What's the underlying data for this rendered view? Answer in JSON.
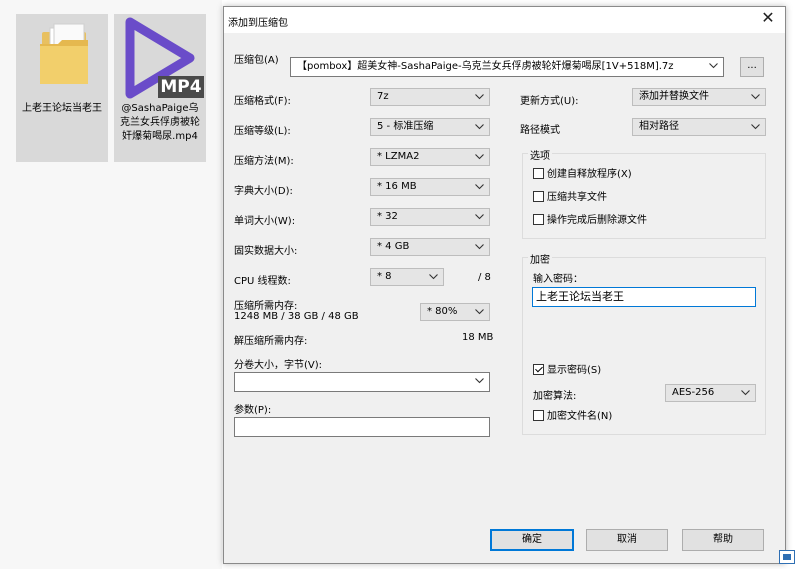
{
  "desktop": {
    "icons": [
      {
        "label": "上老王论坛当老王",
        "icon": "folder-icon"
      },
      {
        "label": "@SashaPaige乌克兰女兵俘虏被轮奸爆菊喝尿.mp4",
        "icon": "mp4-file-icon",
        "badge": "MP4"
      }
    ]
  },
  "dialog": {
    "title": "添加到压缩包",
    "archive_label": "压缩包(A)",
    "archive_value": "【pombox】超美女神-SashaPaige-乌克兰女兵俘虏被轮奸爆菊喝尿[1V+518M].7z",
    "browse_label": "...",
    "left": {
      "format_label": "压缩格式(F):",
      "format_value": "7z",
      "level_label": "压缩等级(L):",
      "level_value": "5 - 标准压缩",
      "method_label": "压缩方法(M):",
      "method_value": "* LZMA2",
      "dict_label": "字典大小(D):",
      "dict_value": "* 16 MB",
      "word_label": "单词大小(W):",
      "word_value": "* 32",
      "solid_label": "固实数据大小:",
      "solid_value": "* 4 GB",
      "threads_label": "CPU 线程数:",
      "threads_value": "* 8",
      "threads_max": "/ 8",
      "mem_comp_label": "压缩所需内存:",
      "mem_comp_value": "1248 MB / 38 GB / 48 GB",
      "mem_percent_value": "* 80%",
      "mem_decomp_label": "解压缩所需内存:",
      "mem_decomp_value": "18 MB",
      "volume_label": "分卷大小，字节(V):",
      "volume_value": "",
      "params_label": "参数(P):",
      "params_value": ""
    },
    "right": {
      "update_label": "更新方式(U):",
      "update_value": "添加并替换文件",
      "path_label": "路径模式",
      "path_value": "相对路径",
      "options_title": "选项",
      "options": [
        {
          "label": "创建自释放程序(X)",
          "checked": false
        },
        {
          "label": "压缩共享文件",
          "checked": false
        },
        {
          "label": "操作完成后删除源文件",
          "checked": false
        }
      ],
      "encrypt_title": "加密",
      "password_label": "输入密码：",
      "password_value": "上老王论坛当老王",
      "show_password_label": "显示密码(S)",
      "show_password_checked": true,
      "algo_label": "加密算法:",
      "algo_value": "AES-256",
      "encrypt_names_label": "加密文件名(N)",
      "encrypt_names_checked": false
    },
    "buttons": {
      "ok": "确定",
      "cancel": "取消",
      "help": "帮助"
    }
  },
  "colors": {
    "accent": "#0078d7",
    "mp4_purple": "#6a4cc9"
  }
}
